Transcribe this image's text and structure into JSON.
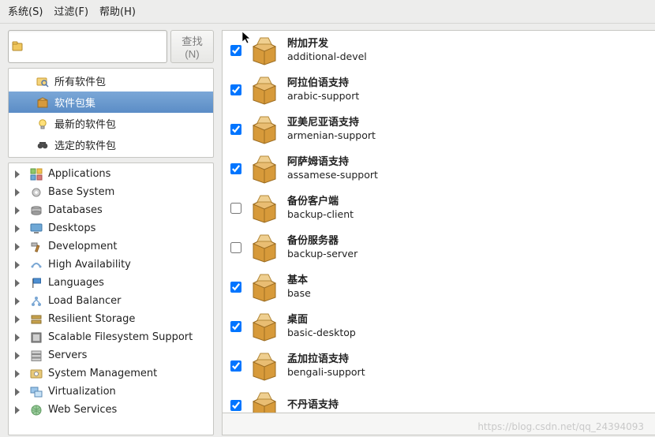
{
  "menubar": {
    "system": "系统(S)",
    "filter": "过滤(F)",
    "help": "帮助(H)"
  },
  "search": {
    "value": "",
    "find_label": "查找(N)"
  },
  "filters": [
    {
      "icon": "magnifier-box-icon",
      "label": "所有软件包",
      "selected": false
    },
    {
      "icon": "package-icon",
      "label": "软件包集",
      "selected": true
    },
    {
      "icon": "lightbulb-icon",
      "label": "最新的软件包",
      "selected": false
    },
    {
      "icon": "binoculars-icon",
      "label": "选定的软件包",
      "selected": false
    }
  ],
  "tree": [
    {
      "icon": "apps-icon",
      "label": "Applications"
    },
    {
      "icon": "gear-icon",
      "label": "Base System"
    },
    {
      "icon": "disk-icon",
      "label": "Databases"
    },
    {
      "icon": "desktop-icon",
      "label": "Desktops"
    },
    {
      "icon": "hammer-icon",
      "label": "Development"
    },
    {
      "icon": "ha-icon",
      "label": "High Availability"
    },
    {
      "icon": "flag-icon",
      "label": "Languages"
    },
    {
      "icon": "lb-icon",
      "label": "Load Balancer"
    },
    {
      "icon": "rs-icon",
      "label": "Resilient Storage"
    },
    {
      "icon": "fs-icon",
      "label": "Scalable Filesystem Support"
    },
    {
      "icon": "servers-icon",
      "label": "Servers"
    },
    {
      "icon": "sysmgmt-icon",
      "label": "System Management"
    },
    {
      "icon": "virt-icon",
      "label": "Virtualization"
    },
    {
      "icon": "web-icon",
      "label": "Web Services"
    }
  ],
  "packages": [
    {
      "checked": true,
      "title": "附加开发",
      "sub": "additional-devel",
      "cursor": true
    },
    {
      "checked": true,
      "title": "阿拉伯语支持",
      "sub": "arabic-support"
    },
    {
      "checked": true,
      "title": "亚美尼亚语支持",
      "sub": "armenian-support"
    },
    {
      "checked": true,
      "title": "阿萨姆语支持",
      "sub": "assamese-support"
    },
    {
      "checked": false,
      "title": "备份客户端",
      "sub": "backup-client"
    },
    {
      "checked": false,
      "title": "备份服务器",
      "sub": "backup-server"
    },
    {
      "checked": true,
      "title": "基本",
      "sub": "base"
    },
    {
      "checked": true,
      "title": "桌面",
      "sub": "basic-desktop"
    },
    {
      "checked": true,
      "title": "孟加拉语支持",
      "sub": "bengali-support"
    },
    {
      "checked": true,
      "title": "不丹语支持",
      "sub": ""
    }
  ],
  "watermark": "https://blog.csdn.net/qq_24394093"
}
